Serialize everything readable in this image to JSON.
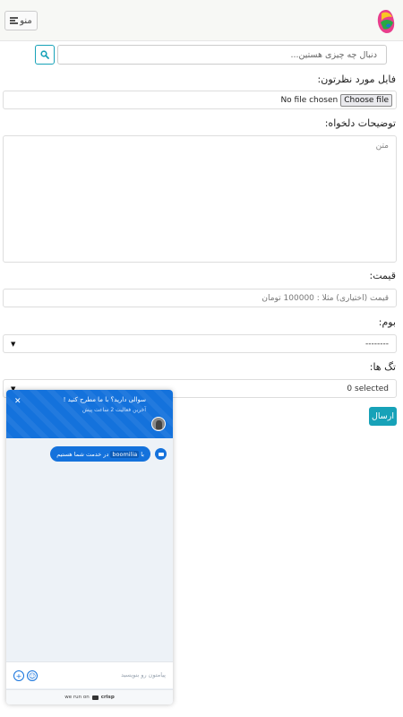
{
  "navbar": {
    "menu_label": "منو"
  },
  "search": {
    "placeholder": "دنبال چه چیزی هستین..."
  },
  "form": {
    "file_label": "فایل مورد نظرتون:",
    "file_button": "Choose file",
    "file_status": "No file chosen",
    "desc_label": "توضیحات دلخواه:",
    "desc_placeholder": "متن",
    "price_label": "قیمت:",
    "price_placeholder": "قیمت (اختیاری) مثلا : 100000 تومان",
    "boom_label": "بوم:",
    "boom_value": "--------",
    "tags_label": "تگ ها:",
    "tags_value": "0 selected",
    "submit_label": "ارسال"
  },
  "chat": {
    "title": "سوالی دارید؟ با ما مطرح کنید !",
    "subtitle": "آخرین فعالیت 2 ساعت پیش",
    "message_prefix": "با",
    "message_brand": "boomilia",
    "message_suffix": "در خدمت شما هستیم",
    "compose_placeholder": "پیامتون رو بنویسید",
    "footer_prefix": "we run on",
    "footer_brand": "crisp"
  },
  "colors": {
    "accent": "#17a2b8",
    "chat_blue": "#1472dc"
  }
}
